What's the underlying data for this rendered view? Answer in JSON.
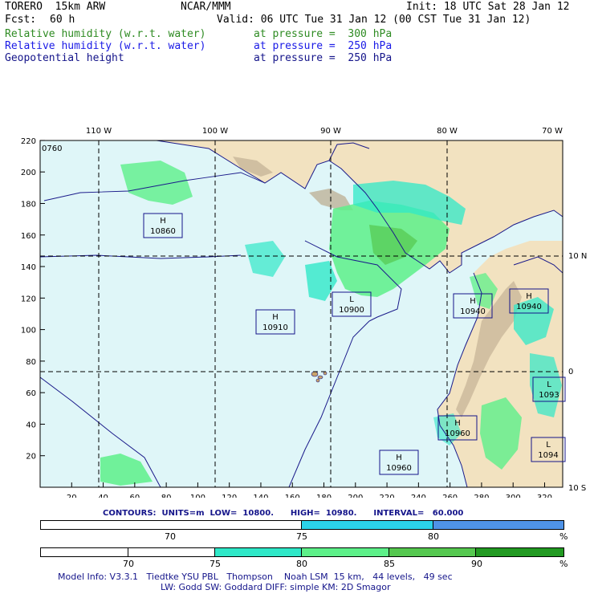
{
  "header": {
    "model": "TORERO  15km ARW",
    "center": "NCAR/MMM",
    "init": "Init: 18 UTC Sat 28 Jan 12",
    "fcst_label": "Fcst:",
    "fcst_value": "60 h",
    "valid": "Valid: 06 UTC Tue 31 Jan 12 (00 CST Tue 31 Jan 12)",
    "fields": [
      {
        "name": "Relative humidity (w.r.t. water)",
        "level": "at pressure =  300 hPa",
        "color": "#2e8b22"
      },
      {
        "name": "Relative humidity (w.r.t. water)",
        "level": "at pressure =  250 hPa",
        "color": "#1a1ae6"
      },
      {
        "name": "Geopotential height",
        "level": "at pressure =  250 hPa",
        "color": "#14148a"
      }
    ]
  },
  "map": {
    "corner_label": "0760",
    "lon_labels": [
      "110 W",
      "100 W",
      "90 W",
      "80 W",
      "70 W"
    ],
    "lat_labels": [
      "10 N",
      "0",
      "10 S"
    ],
    "y_ticks": [
      "220",
      "200",
      "180",
      "160",
      "140",
      "120",
      "100",
      "80",
      "60",
      "40",
      "20"
    ],
    "x_ticks": [
      "20",
      "40",
      "60",
      "80",
      "100",
      "120",
      "140",
      "160",
      "180",
      "200",
      "220",
      "240",
      "260",
      "280",
      "300",
      "320"
    ],
    "centers": [
      {
        "type": "H",
        "value": "10860"
      },
      {
        "type": "H",
        "value": "10910"
      },
      {
        "type": "L",
        "value": "10900"
      },
      {
        "type": "H",
        "value": "10940"
      },
      {
        "type": "H",
        "value": "10940"
      },
      {
        "type": "L",
        "value": "1093"
      },
      {
        "type": "H",
        "value": "10960"
      },
      {
        "type": "L",
        "value": "1094"
      },
      {
        "type": "H",
        "value": "10960"
      }
    ]
  },
  "contours": {
    "text": "CONTOURS:  UNITS=m  LOW=  10800.      HIGH=  10980.      INTERVAL=   60.000"
  },
  "bar1": {
    "labels": [
      "70",
      "75",
      "80"
    ],
    "unit": "%",
    "colors": [
      "#ffffff",
      "#2bd3ea",
      "#4f93e8"
    ]
  },
  "bar2": {
    "labels": [
      "70",
      "75",
      "80",
      "85",
      "90"
    ],
    "unit": "%",
    "colors": [
      "#ffffff",
      "#ffffff",
      "#2fe8c8",
      "#5df089",
      "#55c84f",
      "#229a22"
    ]
  },
  "footer": {
    "line1": "Model Info: V3.3.1   Tiedtke YSU PBL   Thompson    Noah LSM  15 km,   44 levels,   49 sec",
    "line2": "LW: Godd SW: Goddard DIFF: simple KM: 2D Smagor"
  }
}
